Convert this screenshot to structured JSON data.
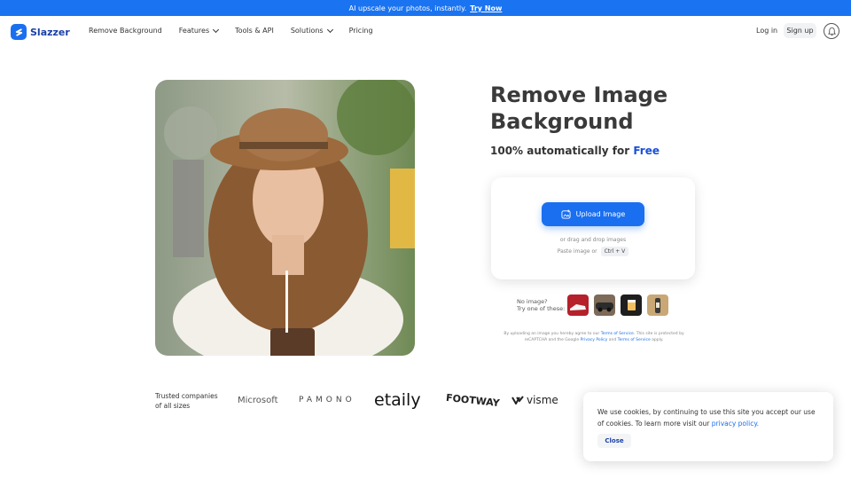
{
  "banner": {
    "text": "AI upscale your photos, instantly.",
    "link": "Try Now"
  },
  "nav": {
    "logo": "Slazzer",
    "links": [
      "Remove Background",
      "Features",
      "Tools & API",
      "Solutions",
      "Pricing"
    ],
    "login": "Log in",
    "signup": "Sign up"
  },
  "hero": {
    "title_line1": "Remove Image",
    "title_line2": "Background",
    "subtitle": "100% automatically for",
    "subtitle_highlight": "Free"
  },
  "upload": {
    "button": "Upload Image",
    "drag_text": "or drag and drop images",
    "paste_text": "Paste image or",
    "shortcut": "Ctrl + V"
  },
  "samples": {
    "line1": "No image?",
    "line2": "Try one of these:"
  },
  "terms": {
    "t1": "By uploading an image you hereby agree to our",
    "l1": "Terms of Service",
    "t2": ". This site is protected by reCAPTCHA and the Google",
    "l2": "Privacy Policy",
    "t3": "and",
    "l3": "Terms of Service",
    "t4": "apply."
  },
  "trusted": {
    "label": "Trusted companies of all sizes",
    "companies": [
      "Microsoft",
      "PAMONO",
      "etaily",
      "FOOTWAY",
      "visme"
    ]
  },
  "cookie": {
    "text": "We use cookies, by continuing to use this site you accept our use of cookies.  To learn more visit our",
    "link": "privacy policy.",
    "close": "Close"
  },
  "colors": {
    "primary": "#1a6ff0",
    "banner": "#1a73f0",
    "brand_dark": "#1a3fa8"
  }
}
